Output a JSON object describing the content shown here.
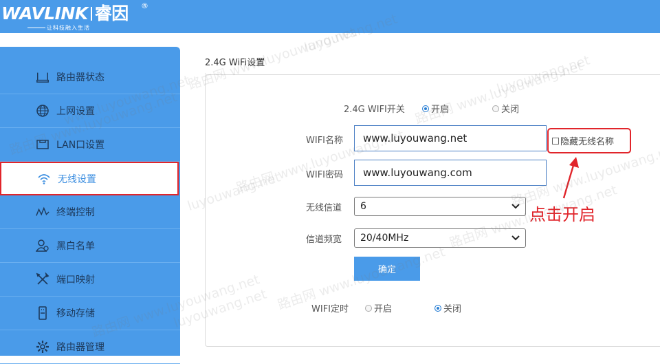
{
  "header": {
    "logo_wav": "WAVLINK",
    "logo_cn": "睿因",
    "logo_reg": "®",
    "tagline": "让科技融入生活"
  },
  "sidebar": {
    "items": [
      {
        "label": "路由器状态",
        "icon": "router-icon"
      },
      {
        "label": "上网设置",
        "icon": "globe-icon"
      },
      {
        "label": "LAN口设置",
        "icon": "lan-port-icon"
      },
      {
        "label": "无线设置",
        "icon": "wifi-icon",
        "active": true
      },
      {
        "label": "终端控制",
        "icon": "wave-icon"
      },
      {
        "label": "黑白名单",
        "icon": "users-icon"
      },
      {
        "label": "端口映射",
        "icon": "tools-icon"
      },
      {
        "label": "移动存储",
        "icon": "storage-icon"
      },
      {
        "label": "路由器管理",
        "icon": "gear-icon"
      }
    ]
  },
  "main": {
    "section_title": "2.4G WiFi设置",
    "wifi_switch": {
      "label": "2.4G WIFI开关",
      "on_label": "开启",
      "off_label": "关闭",
      "selected": "on"
    },
    "ssid": {
      "label": "WIFI名称",
      "value": "www.luyouwang.net"
    },
    "hide_ssid": {
      "label": "隐藏无线名称",
      "checked": false
    },
    "password": {
      "label": "WIFI密码",
      "value": "www.luyouwang.com"
    },
    "channel": {
      "label": "无线信道",
      "value": "6"
    },
    "bandwidth": {
      "label": "信道频宽",
      "value": "20/40MHz"
    },
    "confirm_label": "确定",
    "wifi_timer": {
      "label": "WIFI定时",
      "on_label": "开启",
      "off_label": "关闭",
      "selected": "off"
    }
  },
  "annotation": {
    "text": "点击开启"
  },
  "watermarks": [
    "luyouwang.net",
    "路由网 www.luyouwang.net",
    "路由网 www.luyouwang.net",
    "www.luyouwang.net",
    "路由网 www.luyouwang.net",
    "luyouwang.net",
    "路由网 www.luyouwang.net",
    "路由网 www.luyouwang.net",
    "路由网 www.luyouwang.net",
    "luyouwang.net",
    "路由网 www.luyouwang.net",
    "luyouwang.net",
    "路由网 www.luyouwang.net"
  ],
  "colors": {
    "accent": "#4a9be9",
    "highlight": "#e1252b"
  }
}
